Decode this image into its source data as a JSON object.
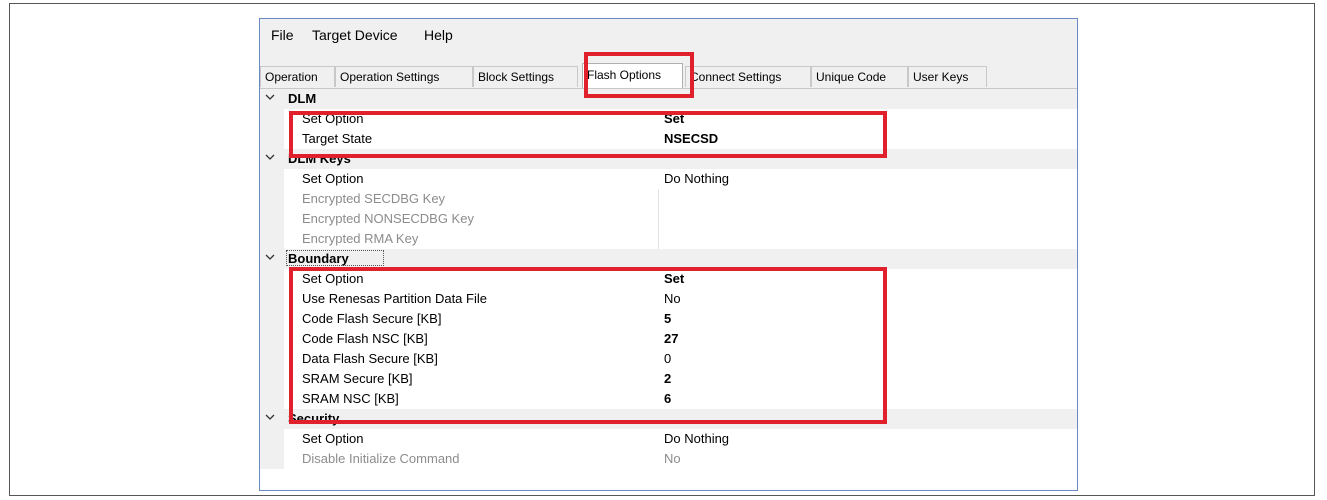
{
  "menu": {
    "file": "File",
    "target_device": "Target Device",
    "help": "Help"
  },
  "tabs": [
    {
      "label": "Operation"
    },
    {
      "label": "Operation Settings"
    },
    {
      "label": "Block Settings"
    },
    {
      "label": "Flash Options"
    },
    {
      "label": "Connect Settings"
    },
    {
      "label": "Unique Code"
    },
    {
      "label": "User Keys"
    }
  ],
  "active_tab": "Flash Options",
  "sections": {
    "dlm": {
      "title": "DLM",
      "rows": [
        {
          "name": "Set Option",
          "value": "Set"
        },
        {
          "name": "Target State",
          "value": "NSECSD"
        }
      ]
    },
    "dlm_keys": {
      "title": "DLM Keys",
      "rows": [
        {
          "name": "Set Option",
          "value": "Do Nothing"
        },
        {
          "name": "Encrypted SECDBG Key",
          "value": ""
        },
        {
          "name": "Encrypted NONSECDBG Key",
          "value": ""
        },
        {
          "name": "Encrypted RMA Key",
          "value": ""
        }
      ]
    },
    "boundary": {
      "title": "Boundary",
      "rows": [
        {
          "name": "Set Option",
          "value": "Set"
        },
        {
          "name": "Use Renesas Partition Data File",
          "value": "No"
        },
        {
          "name": "Code Flash Secure [KB]",
          "value": "5"
        },
        {
          "name": "Code Flash NSC [KB]",
          "value": "27"
        },
        {
          "name": "Data Flash Secure [KB]",
          "value": "0"
        },
        {
          "name": "SRAM Secure [KB]",
          "value": "2"
        },
        {
          "name": "SRAM NSC [KB]",
          "value": "6"
        }
      ]
    },
    "security": {
      "title": "Security",
      "rows": [
        {
          "name": "Set Option",
          "value": "Do Nothing"
        },
        {
          "name": "Disable Initialize Command",
          "value": "No"
        }
      ]
    }
  },
  "colors": {
    "highlight": "#e0202a",
    "window_border": "#6b8ac2",
    "disabled_text": "#8c8c8c",
    "category_bg": "#f0f0f0"
  },
  "icons": {
    "expander": "chevron-down-icon"
  }
}
